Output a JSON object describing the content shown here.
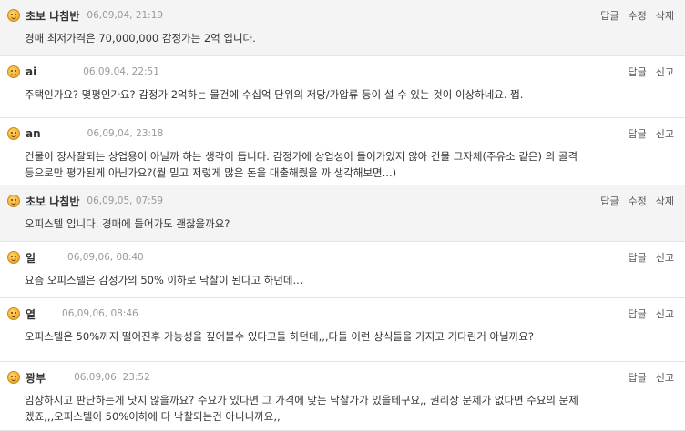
{
  "comments": [
    {
      "author_name": "초보 나침반",
      "is_author": true,
      "date": "06,09,04, 21:19",
      "text": "경매 최저가격은 70,000,000 감정가는 2억 입니다.",
      "actions": [
        "답글",
        "수정",
        "삭제"
      ]
    },
    {
      "author_name": "ai",
      "is_author": false,
      "date": "06,09,04, 22:51",
      "text": "주택인가요? 몇평인가요? 감정가 2억하는 물건에 수십억 단위의 저당/가압류 등이 설 수 있는 것이 이상하네요. 쩝.",
      "actions": [
        "답글",
        "신고"
      ]
    },
    {
      "author_name": "an",
      "is_author": false,
      "date": "06,09,04, 23:18",
      "text": "건물이 장사잘되는 상업용이 아닐까 하는 생각이 듭니다. 감정가에 상업성이 들어가있지 않아 건물 그자체(주유소 같은) 의 골격\n등으로만 평가된게 아닌가요?(뭘 믿고 저렇게 많은 돈을 대출해줬을 까 생각해보면...)",
      "actions": [
        "답글",
        "신고"
      ]
    },
    {
      "author_name": "초보 나침반",
      "is_author": true,
      "date": "06,09,05, 07:59",
      "text": "오피스텔 입니다. 경매에 들어가도 괜찮을까요?",
      "actions": [
        "답글",
        "수정",
        "삭제"
      ]
    },
    {
      "author_name": "일",
      "is_author": false,
      "date": "06,09,06, 08:40",
      "text": "요즘 오피스텔은 감정가의 50% 이하로 낙찰이 된다고 하던데...",
      "actions": [
        "답글",
        "신고"
      ]
    },
    {
      "author_name": "열",
      "is_author": false,
      "date": "06,09,06, 08:46",
      "text": "오피스텔은 50%까지 떨어진후 가능성을 짚어볼수 있다고들 하던데,,,다들 이런 상식들을 가지고 기다린거 아닐까요?",
      "actions": [
        "답글",
        "신고"
      ]
    },
    {
      "author_name": "꽝부",
      "is_author": false,
      "date": "06,09,06, 23:52",
      "text": "임장하시고 판단하는게 낫지 않을까요? 수요가 있다면 그 가격에 맞는 낙찰가가 있을테구요,, 권리상 문제가 없다면 수요의 문제\n겠죠,,,오피스텔이 50%이하에 다 낙찰되는건 아니니까요,,",
      "actions": [
        "답글",
        "신고"
      ]
    }
  ]
}
